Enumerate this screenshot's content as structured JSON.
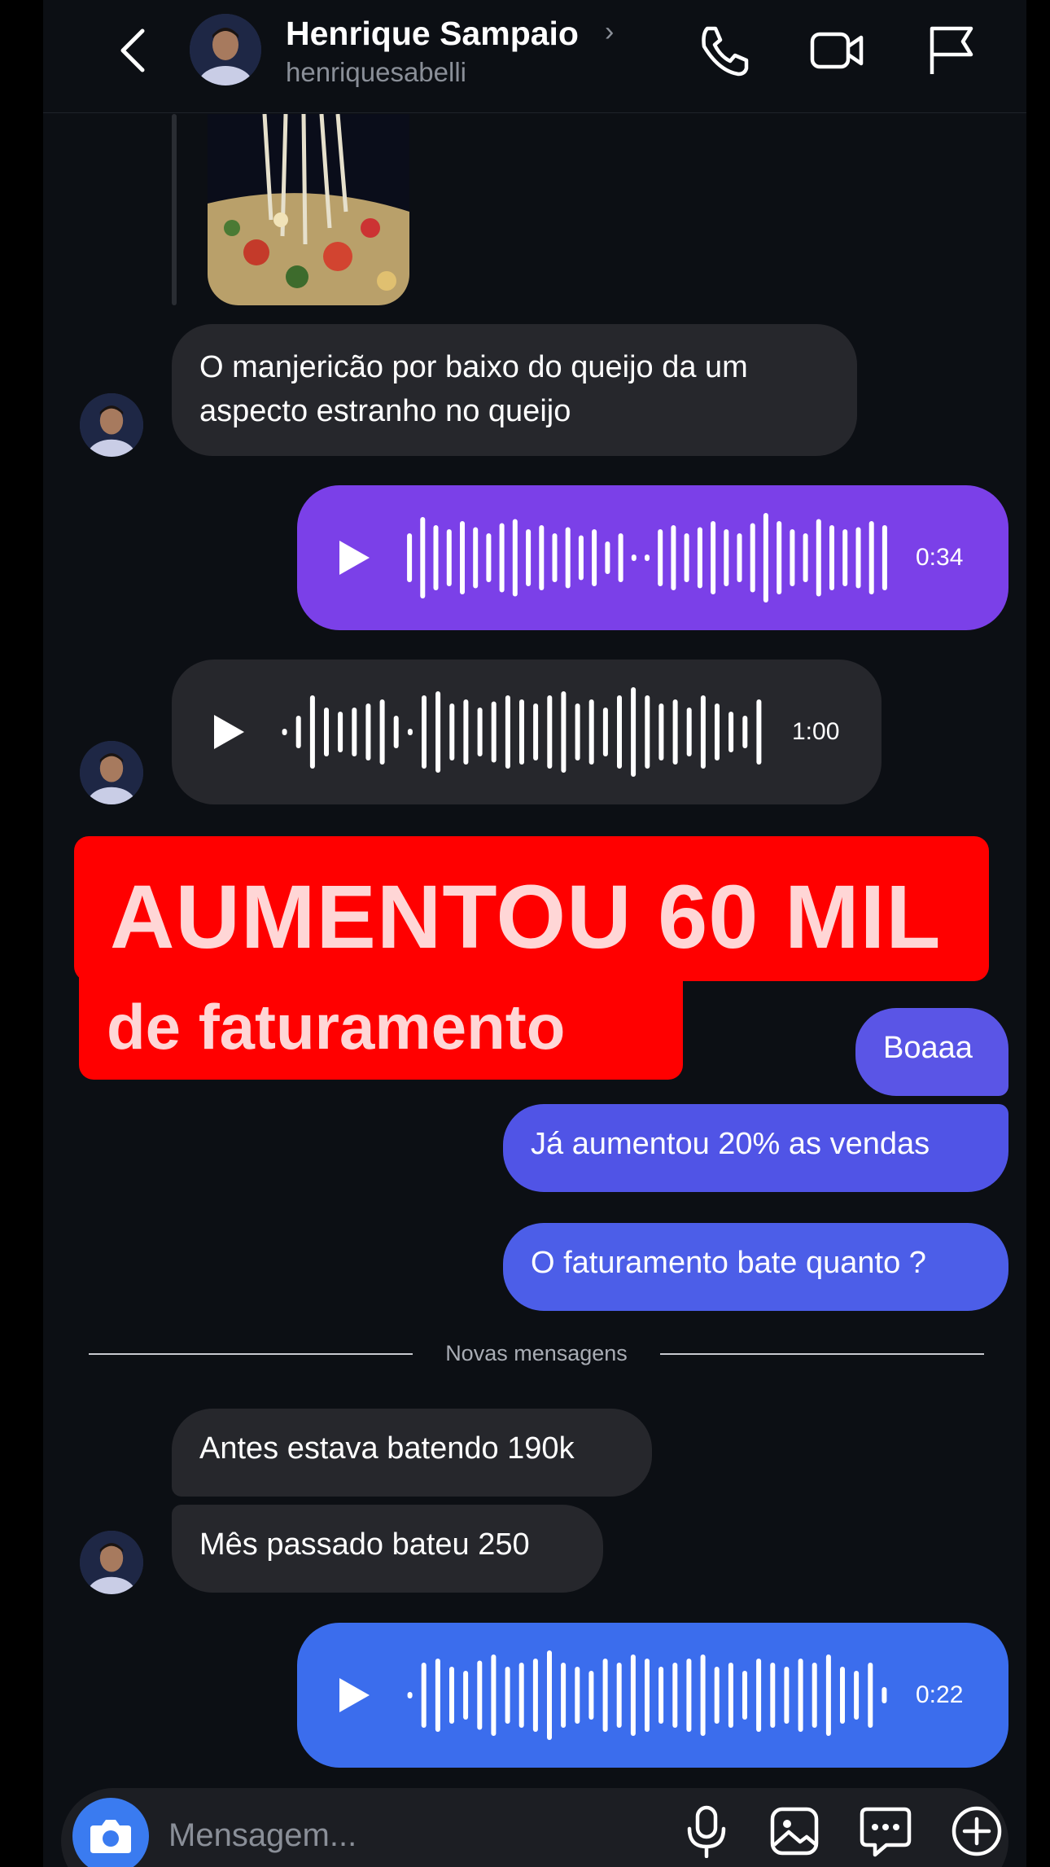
{
  "header": {
    "name": "Henrique Sampaio",
    "chevron": "›",
    "username": "henriquesabelli",
    "icons": [
      "back-arrow-icon",
      "phone-icon",
      "video-icon",
      "flag-icon"
    ]
  },
  "messages": {
    "in_1": "O manjericão por baixo do queijo da um aspecto estranho no queijo",
    "voice_out_1": "0:34",
    "voice_in_1": "1:00",
    "out_boaaa": "Boaaa",
    "out_vendas": "Já aumentou 20% as vendas",
    "out_fat": "O faturamento bate quanto ?",
    "divider": "Novas mensagens",
    "in_antes": "Antes estava batendo 190k",
    "in_mes": "Mês passado bateu 250",
    "voice_out_2": "0:22"
  },
  "banner": {
    "line1": "AUMENTOU 60 MIL",
    "line2": "de faturamento"
  },
  "composer": {
    "placeholder": "Mensagem...",
    "icons": [
      "camera-icon",
      "microphone-icon",
      "gallery-icon",
      "sticker-icon",
      "plus-icon"
    ]
  },
  "colors": {
    "background": "#0c0f14",
    "incoming": "#26272c",
    "voice_purple": "#7b40e8",
    "bubble_indigo": "#5a55e6",
    "bubble_blue": "#4c5ee8",
    "voice_blue": "#3b6ded",
    "banner_red": "#ff0000",
    "banner_text": "#ffd6d6"
  }
}
